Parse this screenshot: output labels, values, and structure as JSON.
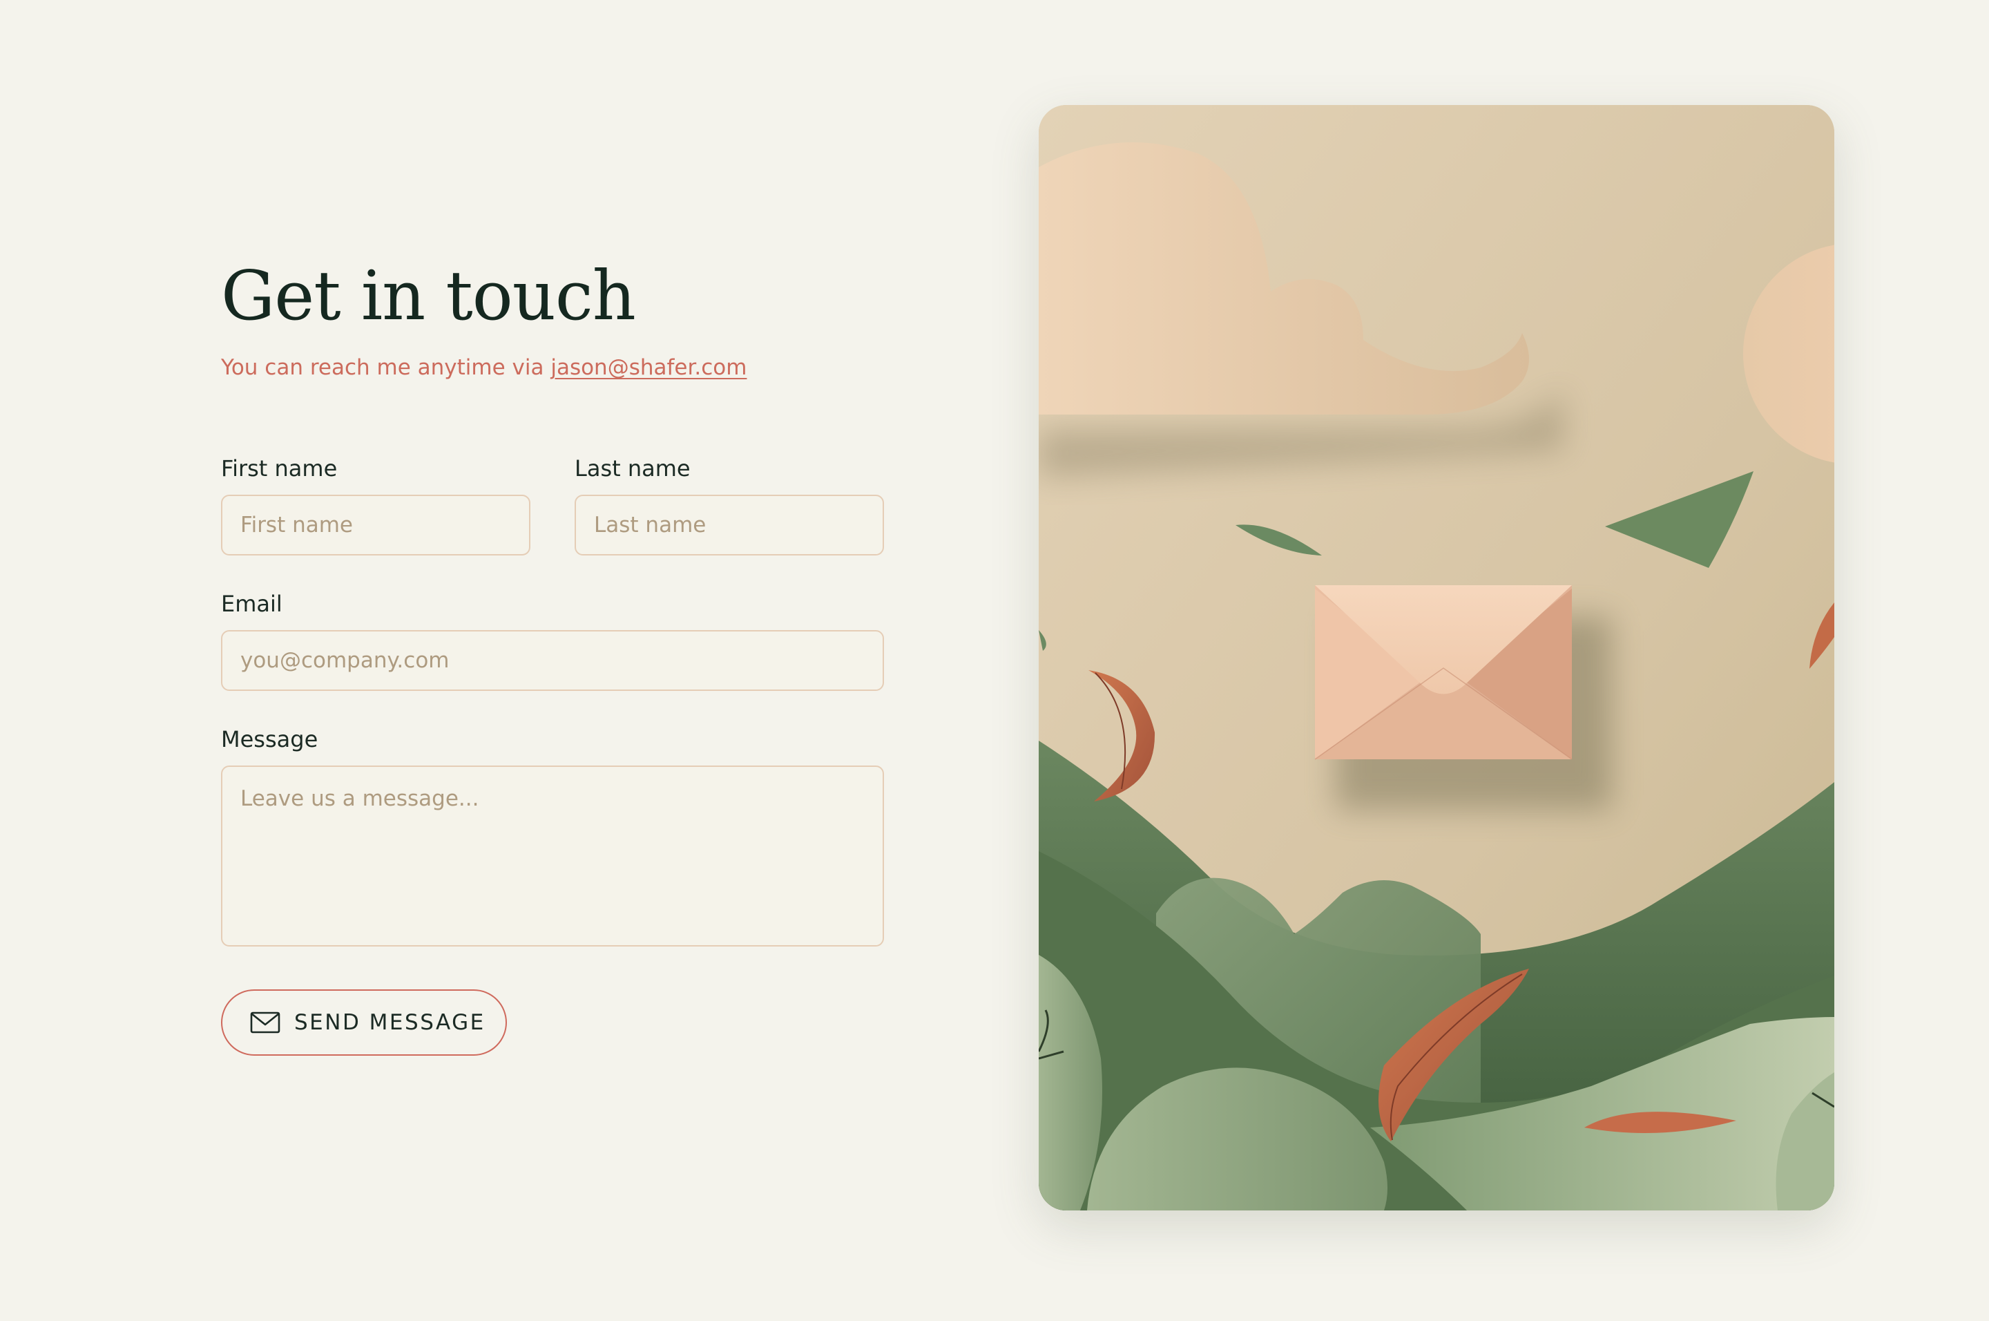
{
  "heading": {
    "title": "Get in touch",
    "subtitle_prefix": "You can reach me anytime via ",
    "email_link": "jason@shafer.com"
  },
  "form": {
    "first_name": {
      "label": "First name",
      "placeholder": "First name",
      "value": ""
    },
    "last_name": {
      "label": "Last name",
      "placeholder": "Last name",
      "value": ""
    },
    "email": {
      "label": "Email",
      "placeholder": "you@company.com",
      "value": ""
    },
    "message": {
      "label": "Message",
      "placeholder": "Leave us a message...",
      "value": ""
    },
    "submit": {
      "label": "SEND MESSAGE",
      "icon": "envelope-icon"
    }
  },
  "illustration": {
    "subject": "paper-cut envelope among clouds, hills and leaves",
    "palette": {
      "sky": "#d9c8a9",
      "cloud": "#e9cfb1",
      "envelope": "#efc9ad",
      "hill_green": "#5f7a55",
      "light_green": "#a9ba98",
      "leaf_rust": "#c0684a"
    }
  },
  "colors": {
    "background": "#f4f3ec",
    "accent": "#cc6b5c",
    "heading": "#152820",
    "input_border": "#e5cdb6",
    "placeholder": "#ae9b80"
  }
}
